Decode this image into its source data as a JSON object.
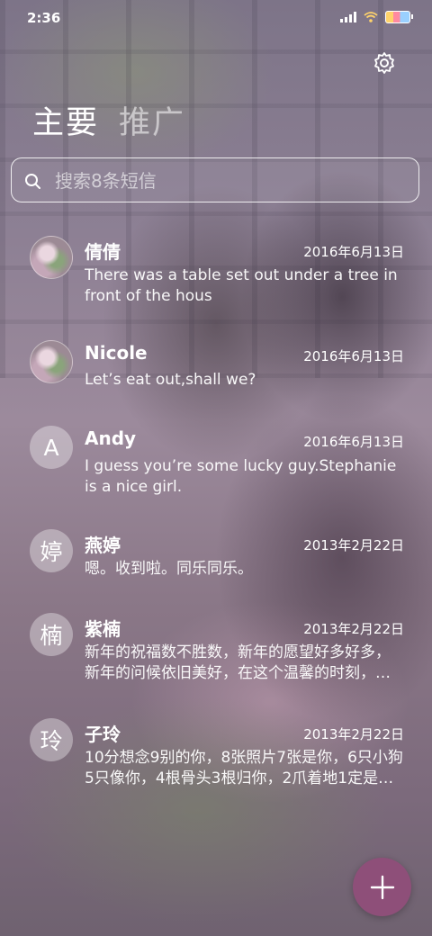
{
  "status_bar": {
    "time": "2:36"
  },
  "tabs": [
    {
      "label": "主要"
    },
    {
      "label": "推广"
    }
  ],
  "search": {
    "placeholder": "搜索8条短信"
  },
  "messages": [
    {
      "name": "倩倩",
      "date": "2016年6月13日",
      "text": "There was a table set out under a tree in front of the hous",
      "avatar": "photo"
    },
    {
      "name": "Nicole",
      "date": "2016年6月13日",
      "text": "Let’s eat out,shall we?",
      "avatar": "photo"
    },
    {
      "name": "Andy",
      "date": "2016年6月13日",
      "text": "I guess you’re some lucky guy.Stephanie is a nice girl.",
      "avatar_letter": "A"
    },
    {
      "name": "燕婷",
      "date": "2013年2月22日",
      "text": "嗯。收到啦。同乐同乐。",
      "avatar_letter": "婷"
    },
    {
      "name": "紫楠",
      "date": "2013年2月22日",
      "text": "新年的祝福数不胜数，新年的愿望好多好多，新年的问候依旧美好，在这个温馨的时刻，…",
      "avatar_letter": "楠"
    },
    {
      "name": "子玲",
      "date": "2013年2月22日",
      "text": "10分想念9别的你，8张照片7张是你，6只小狗5只像你，4根骨头3根归你，2爪着地1定是…",
      "avatar_letter": "玲"
    }
  ],
  "icons": {
    "settings": "gear-icon",
    "search": "search-icon",
    "compose": "plus-icon"
  },
  "colors": {
    "fab": "#8e4f79"
  }
}
